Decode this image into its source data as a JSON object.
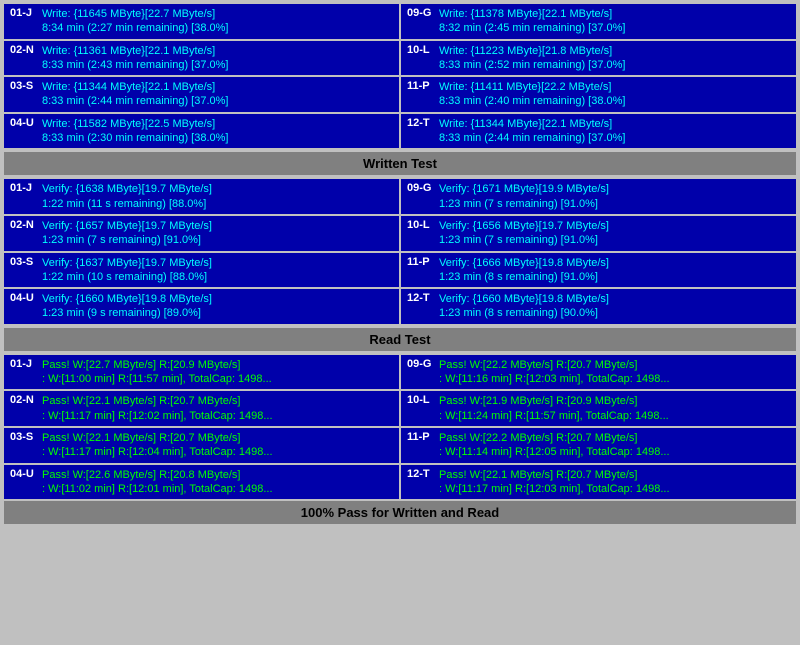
{
  "sections": {
    "write_test": {
      "label": "Written Test",
      "rows": [
        {
          "left": {
            "id": "01-J",
            "line1": "Write: {11645 MByte}[22.7 MByte/s]",
            "line2": "8:34 min (2:27 min remaining)  [38.0%]"
          },
          "right": {
            "id": "09-G",
            "line1": "Write: {11378 MByte}[22.1 MByte/s]",
            "line2": "8:32 min (2:45 min remaining)  [37.0%]"
          }
        },
        {
          "left": {
            "id": "02-N",
            "line1": "Write: {11361 MByte}[22.1 MByte/s]",
            "line2": "8:33 min (2:43 min remaining)  [37.0%]"
          },
          "right": {
            "id": "10-L",
            "line1": "Write: {11223 MByte}[21.8 MByte/s]",
            "line2": "8:33 min (2:52 min remaining)  [37.0%]"
          }
        },
        {
          "left": {
            "id": "03-S",
            "line1": "Write: {11344 MByte}[22.1 MByte/s]",
            "line2": "8:33 min (2:44 min remaining)  [37.0%]"
          },
          "right": {
            "id": "11-P",
            "line1": "Write: {11411 MByte}[22.2 MByte/s]",
            "line2": "8:33 min (2:40 min remaining)  [38.0%]"
          }
        },
        {
          "left": {
            "id": "04-U",
            "line1": "Write: {11582 MByte}[22.5 MByte/s]",
            "line2": "8:33 min (2:30 min remaining)  [38.0%]"
          },
          "right": {
            "id": "12-T",
            "line1": "Write: {11344 MByte}[22.1 MByte/s]",
            "line2": "8:33 min (2:44 min remaining)  [37.0%]"
          }
        }
      ]
    },
    "verify_test": {
      "rows": [
        {
          "left": {
            "id": "01-J",
            "line1": "Verify: {1638 MByte}[19.7 MByte/s]",
            "line2": "1:22 min (11 s remaining)  [88.0%]"
          },
          "right": {
            "id": "09-G",
            "line1": "Verify: {1671 MByte}[19.9 MByte/s]",
            "line2": "1:23 min (7 s remaining)   [91.0%]"
          }
        },
        {
          "left": {
            "id": "02-N",
            "line1": "Verify: {1657 MByte}[19.7 MByte/s]",
            "line2": "1:23 min (7 s remaining)   [91.0%]"
          },
          "right": {
            "id": "10-L",
            "line1": "Verify: {1656 MByte}[19.7 MByte/s]",
            "line2": "1:23 min (7 s remaining)   [91.0%]"
          }
        },
        {
          "left": {
            "id": "03-S",
            "line1": "Verify: {1637 MByte}[19.7 MByte/s]",
            "line2": "1:22 min (10 s remaining)  [88.0%]"
          },
          "right": {
            "id": "11-P",
            "line1": "Verify: {1666 MByte}[19.8 MByte/s]",
            "line2": "1:23 min (8 s remaining)   [91.0%]"
          }
        },
        {
          "left": {
            "id": "04-U",
            "line1": "Verify: {1660 MByte}[19.8 MByte/s]",
            "line2": "1:23 min (9 s remaining)   [89.0%]"
          },
          "right": {
            "id": "12-T",
            "line1": "Verify: {1660 MByte}[19.8 MByte/s]",
            "line2": "1:23 min (8 s remaining)   [90.0%]"
          }
        }
      ]
    },
    "read_test": {
      "label": "Read Test",
      "rows": [
        {
          "left": {
            "id": "01-J",
            "line1": "Pass! W:[22.7 MByte/s] R:[20.9 MByte/s]",
            "line2": ": W:[11:00 min] R:[11:57 min], TotalCap: 1498..."
          },
          "right": {
            "id": "09-G",
            "line1": "Pass! W:[22.2 MByte/s] R:[20.7 MByte/s]",
            "line2": ": W:[11:16 min] R:[12:03 min], TotalCap: 1498..."
          }
        },
        {
          "left": {
            "id": "02-N",
            "line1": "Pass! W:[22.1 MByte/s] R:[20.7 MByte/s]",
            "line2": ": W:[11:17 min] R:[12:02 min], TotalCap: 1498..."
          },
          "right": {
            "id": "10-L",
            "line1": "Pass! W:[21.9 MByte/s] R:[20.9 MByte/s]",
            "line2": ": W:[11:24 min] R:[11:57 min], TotalCap: 1498..."
          }
        },
        {
          "left": {
            "id": "03-S",
            "line1": "Pass! W:[22.1 MByte/s] R:[20.7 MByte/s]",
            "line2": ": W:[11:17 min] R:[12:04 min], TotalCap: 1498..."
          },
          "right": {
            "id": "11-P",
            "line1": "Pass! W:[22.2 MByte/s] R:[20.7 MByte/s]",
            "line2": ": W:[11:14 min] R:[12:05 min], TotalCap: 1498..."
          }
        },
        {
          "left": {
            "id": "04-U",
            "line1": "Pass! W:[22.6 MByte/s] R:[20.8 MByte/s]",
            "line2": ": W:[11:02 min] R:[12:01 min], TotalCap: 1498..."
          },
          "right": {
            "id": "12-T",
            "line1": "Pass! W:[22.1 MByte/s] R:[20.7 MByte/s]",
            "line2": ": W:[11:17 min] R:[12:03 min], TotalCap: 1498..."
          }
        }
      ]
    }
  },
  "footer": {
    "label": "100% Pass for Written and Read"
  },
  "headers": {
    "written": "Written Test",
    "read": "Read Test"
  }
}
